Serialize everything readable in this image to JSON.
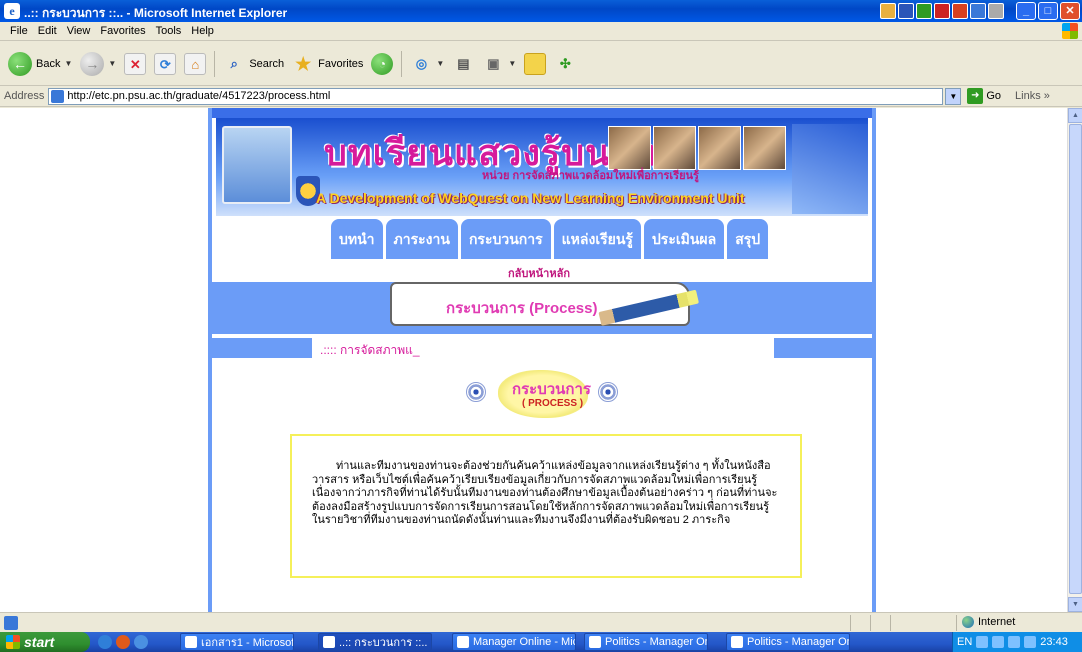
{
  "window": {
    "title": "..:: กระบวนการ ::.. - Microsoft Internet Explorer"
  },
  "menu": [
    "File",
    "Edit",
    "View",
    "Favorites",
    "Tools",
    "Help"
  ],
  "toolbar": {
    "back_label": "Back",
    "search_label": "Search",
    "favorites_label": "Favorites"
  },
  "address": {
    "label": "Address",
    "url": "http://etc.pn.psu.ac.th/graduate/4517223/process.html",
    "go_label": "Go",
    "links_label": "Links"
  },
  "page": {
    "banner_title": "บทเรียนแสวงรู้บนเว็บ",
    "banner_unit": "หน่วย การจัดสภาพแวดล้อมใหม่เพื่อการเรียนรู้",
    "banner_english": "A Development of WebQuest on New Learning Environment Unit",
    "nav": [
      "บทนำ",
      "ภาระงาน",
      "กระบวนการ",
      "แหล่งเรียนรู้",
      "ประเมินผล",
      "สรุป"
    ],
    "home_link": "กลับหน้าหลัก",
    "process_heading": "กระบวนการ (Process)",
    "marquee": ".:::: การจัดสภาพแ_",
    "emblem_title": "กระบวนการ",
    "emblem_subtitle": "( PROCESS )",
    "body_text": "ท่านและทีมงานของท่านจะต้องช่วยกันค้นคว้าแหล่งข้อมูลจากแหล่งเรียนรู้ต่าง ๆ ทั้งในหนังสือ วารสาร หรือเว็บไซต์เพื่อค้นคว้าเรียบเรียงข้อมูลเกี่ยวกับการจัดสภาพแวดล้อมใหม่เพื่อการเรียนรู้ เนื่องจากว่าภารกิจที่ท่านได้รับนั้นทีมงานของท่านต้องศึกษาข้อมูลเบื้องต้นอย่างคร่าว ๆ ก่อนที่ท่านจะต้องลงมือสร้างรูปแบบการจัดการเรียนการสอนโดยใช้หลักการจัดสภาพแวดล้อมใหม่เพื่อการเรียนรู้ในรายวิชาที่ทีมงานของท่านถนัดดังนั้นท่านและทีมงานจึงมีงานที่ต้องรับผิดชอบ 2 ภาระกิจ"
  },
  "status": {
    "zone": "Internet"
  },
  "taskbar": {
    "start_label": "start",
    "tasks": [
      "เอกสาร1 - Microsoft ...",
      "..:: กระบวนการ ::.. - ...",
      "Manager Online - Micr...",
      "Politics - Manager Onl...",
      "Politics - Manager Onl..."
    ],
    "lang": "EN",
    "clock": "23:43"
  }
}
